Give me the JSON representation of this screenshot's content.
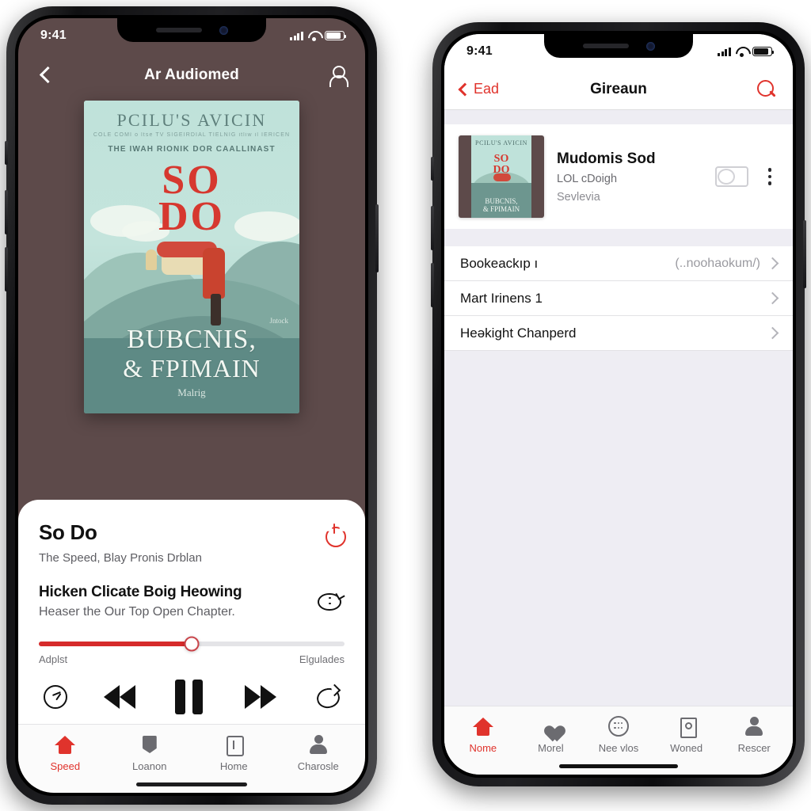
{
  "left_phone": {
    "status_bar": {
      "time": "9:41",
      "signal_icon": "cellular-bars-icon",
      "wifi_icon": "wifi-icon",
      "battery_icon": "battery-icon"
    },
    "nav": {
      "back_icon": "chevron-left-icon",
      "title": "Ar Audiomed",
      "profile_icon": "person-icon"
    },
    "cover": {
      "line1": "PCILU'S AVICIN",
      "line2": "COLE COMI o ltse TV SIGEIRDIAL TIELNIG itliw  il IERICEN",
      "line3": "THE IWAH RIONIK DOR CAALLINAST",
      "big1": "SO",
      "big2": "DO",
      "bottom1": "BUBCNIS,",
      "bottom2": "& FPIMAIN",
      "bottom3": "Malrig",
      "small_note": "Jntock"
    },
    "player": {
      "title": "So Do",
      "subtitle": "The Speed, Blay Pronis Drblan",
      "power_icon": "power-icon",
      "chapter_title": "Hicken Clicate Boig Heowing",
      "chapter_subtitle": "Heaser the Our Top Open Chapter.",
      "timer_icon": "sleep-timer-icon",
      "progress_percent": 50,
      "time_left_label": "Adplst",
      "time_right_label": "Elgulades",
      "controls": {
        "speed_icon": "playback-speed-icon",
        "rewind_icon": "rewind-icon",
        "pause_icon": "pause-icon",
        "forward_icon": "fast-forward-icon",
        "loop_icon": "repeat-icon"
      }
    },
    "tabs": [
      {
        "label": "Speed",
        "icon": "home-icon",
        "active": true
      },
      {
        "label": "Loanon",
        "icon": "bookmark-shield-icon",
        "active": false
      },
      {
        "label": "Home",
        "icon": "upload-document-icon",
        "active": false
      },
      {
        "label": "Charosle",
        "icon": "person-icon",
        "active": false
      }
    ]
  },
  "right_phone": {
    "status_bar": {
      "time": "9:41",
      "signal_icon": "cellular-bars-icon",
      "wifi_icon": "wifi-icon",
      "battery_icon": "battery-icon"
    },
    "nav": {
      "back_label": "Ead",
      "back_icon": "chevron-left-icon",
      "title": "Gireaun",
      "search_icon": "search-icon"
    },
    "media": {
      "thumb": {
        "line1": "PCILU'S AVICIN",
        "so": "SO",
        "do": "DO",
        "bottom1": "BUBCNIS,",
        "bottom2": "& FPIMAIN"
      },
      "title": "Mudomis Sod",
      "sub1": "LOL cDoigh",
      "sub2": "Sevlevia",
      "toggle_icon": "toggle-switch-off-icon",
      "menu_icon": "kebab-menu-icon"
    },
    "settings_rows": [
      {
        "label": "Bookeackıp ı",
        "value": "(..noohaokum/)",
        "chevron": "chevron-right-icon"
      },
      {
        "label": "Mart Irinens 1",
        "value": "",
        "chevron": "chevron-right-icon"
      },
      {
        "label": "Heəkight Chanperd",
        "value": "",
        "chevron": "chevron-right-icon"
      }
    ],
    "tabs": [
      {
        "label": "Nome",
        "icon": "home-icon",
        "active": true
      },
      {
        "label": "Morel",
        "icon": "heart-icon",
        "active": false
      },
      {
        "label": "Nee vlos",
        "icon": "grid-dots-icon",
        "active": false
      },
      {
        "label": "Woned",
        "icon": "device-card-icon",
        "active": false
      },
      {
        "label": "Rescer",
        "icon": "person-icon",
        "active": false
      }
    ]
  },
  "colors": {
    "accent_red": "#e0332c",
    "progress_red": "#d62b2b",
    "left_bg": "#5d4a4a",
    "right_bg": "#eeedf3",
    "cover_teal": "#bfe2da"
  }
}
